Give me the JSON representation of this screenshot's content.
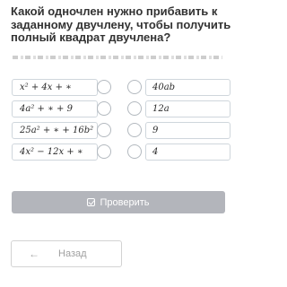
{
  "question": "Какой одночлен нужно прибавить к заданному двучлену, чтобы получить полный квадрат двучлена?",
  "rows": [
    {
      "expression": "x² + 4x + ∗",
      "answer": "40ab"
    },
    {
      "expression": "4a² + ∗ + 9",
      "answer": "12a"
    },
    {
      "expression": "25a² + ∗ + 16b²",
      "answer": "9"
    },
    {
      "expression": "4x² − 12x + ∗",
      "answer": "4"
    }
  ],
  "check_button": {
    "label": "Проверить",
    "icon": "checkbox-icon"
  },
  "back_button": {
    "label": "Назад",
    "icon": "arrow-left-icon"
  },
  "colors": {
    "check_button_bg": "#b3b5bb",
    "border": "#cfd6dc"
  }
}
